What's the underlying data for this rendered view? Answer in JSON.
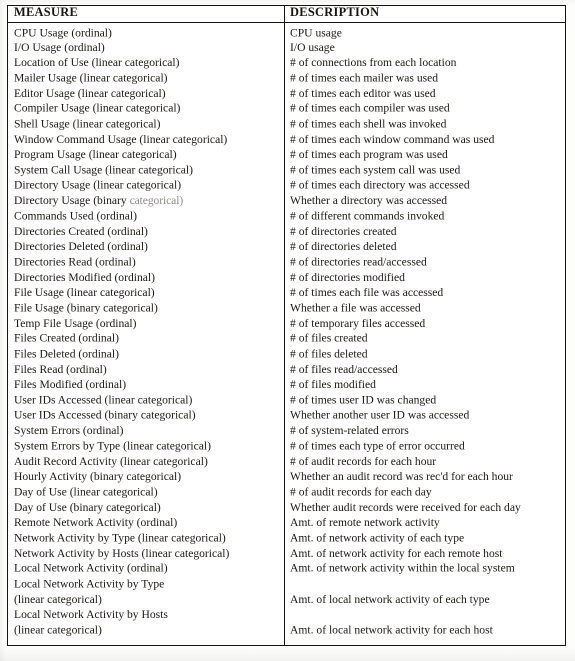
{
  "table": {
    "headers": {
      "measure": "MEASURE",
      "description": "DESCRIPTION"
    },
    "rows": [
      {
        "measure": "CPU Usage (ordinal)",
        "description": "CPU usage"
      },
      {
        "measure": "I/O Usage (ordinal)",
        "description": "I/O usage"
      },
      {
        "measure": "Location of Use (linear categorical)",
        "description": "# of connections from each location"
      },
      {
        "measure": "Mailer Usage (linear categorical)",
        "description": "# of times each mailer was used"
      },
      {
        "measure": "Editor Usage (linear categorical)",
        "description": "# of times each editor was used"
      },
      {
        "measure": "Compiler Usage (linear categorical)",
        "description": "# of times each compiler was used"
      },
      {
        "measure": "Shell Usage (linear categorical)",
        "description": "# of times each shell was invoked"
      },
      {
        "measure": "Window Command Usage (linear categorical)",
        "description": "# of times each window command was used"
      },
      {
        "measure": "Program Usage (linear categorical)",
        "description": "# of times each program was used"
      },
      {
        "measure": "System Call Usage (linear categorical)",
        "description": "# of times each system call was used"
      },
      {
        "measure": "Directory Usage (linear categorical)",
        "description": "# of times each directory was accessed"
      },
      {
        "measure": "Directory Usage (binary categorical)",
        "measure_head": "Directory Usage (binary ",
        "measure_tail": "categorical)",
        "faded": true,
        "description": "Whether a directory was accessed"
      },
      {
        "measure": "Commands Used (ordinal)",
        "description": "# of different commands invoked"
      },
      {
        "measure": "Directories Created (ordinal)",
        "description": "# of directories created"
      },
      {
        "measure": "Directories Deleted (ordinal)",
        "description": "# of directories deleted"
      },
      {
        "measure": "Directories Read (ordinal)",
        "description": "# of directories read/accessed"
      },
      {
        "measure": "Directories Modified (ordinal)",
        "description": "# of directories modified"
      },
      {
        "measure": "File Usage (linear categorical)",
        "description": "# of times each file was accessed"
      },
      {
        "measure": "File Usage (binary categorical)",
        "description": "Whether a file was accessed"
      },
      {
        "measure": "Temp File Usage (ordinal)",
        "description": "# of temporary files accessed"
      },
      {
        "measure": "Files Created (ordinal)",
        "description": "# of files created"
      },
      {
        "measure": "Files Deleted (ordinal)",
        "description": "# of files deleted"
      },
      {
        "measure": "Files Read (ordinal)",
        "description": "# of files read/accessed"
      },
      {
        "measure": "Files Modified (ordinal)",
        "description": "# of files modified"
      },
      {
        "measure": "User IDs Accessed (linear categorical)",
        "description": "# of times user ID was changed"
      },
      {
        "measure": "User IDs Accessed (binary categorical)",
        "description": "Whether another user ID was accessed"
      },
      {
        "measure": "System Errors (ordinal)",
        "description": "# of system-related errors"
      },
      {
        "measure": "System Errors by Type (linear categorical)",
        "description": "# of times each type of error occurred"
      },
      {
        "measure": "Audit Record Activity (linear categorical)",
        "description": "# of audit records for each hour"
      },
      {
        "measure": "Hourly Activity (binary categorical)",
        "description": "Whether an audit record was rec'd for each hour"
      },
      {
        "measure": "Day of Use (linear categorical)",
        "description": "# of audit records for each day"
      },
      {
        "measure": "Day of Use (binary categorical)",
        "description": "Whether audit records were received for each day"
      },
      {
        "measure": "Remote Network Activity (ordinal)",
        "description": "Amt. of remote network activity"
      },
      {
        "measure": "Network Activity by Type (linear categorical)",
        "description": "Amt. of network activity of each type"
      },
      {
        "measure": "Network Activity by Hosts (linear categorical)",
        "description": "Amt. of network activity for each remote host"
      },
      {
        "measure": "Local Network Activity (ordinal)",
        "description": "Amt. of network activity within the local system"
      },
      {
        "measure": "Local Network Activity by Type",
        "description": ""
      },
      {
        "measure": "(linear categorical)",
        "description": "Amt. of local network activity of each type"
      },
      {
        "measure": "Local Network Activity by Hosts",
        "description": ""
      },
      {
        "measure": "(linear categorical)",
        "description": "Amt. of local network activity for each host"
      }
    ]
  }
}
